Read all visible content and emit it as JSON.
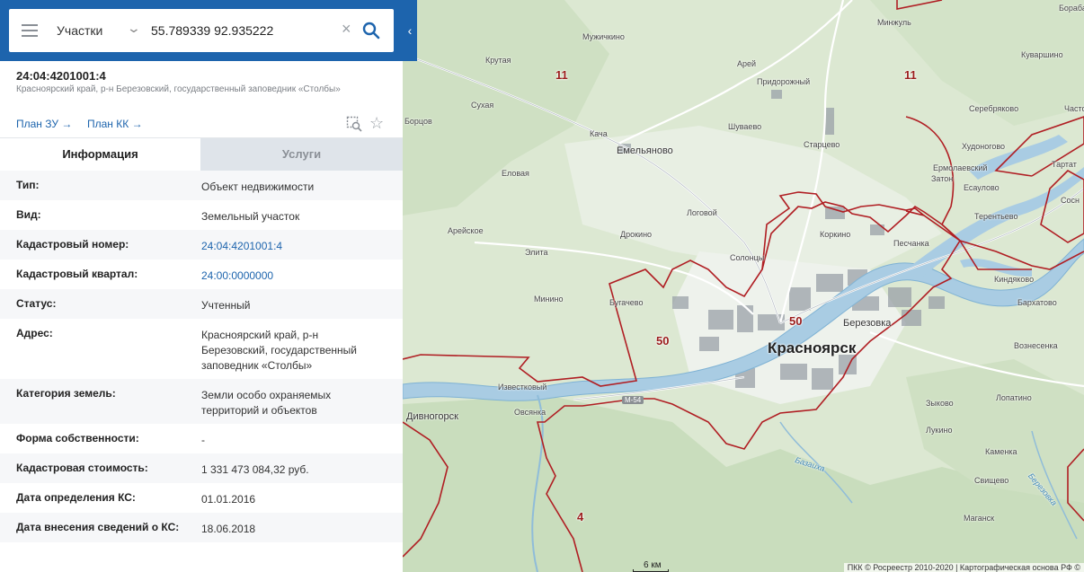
{
  "search": {
    "type_label": "Участки",
    "query": "55.789339 92.935222"
  },
  "icons": {
    "menu": "menu-icon",
    "chevron": "chevron-down-icon",
    "clear": "close-icon",
    "search": "search-icon",
    "collapse": "chevron-left-icon",
    "zoom": "zoom-to-object-icon",
    "favorite": "star-icon"
  },
  "colors": {
    "brand": "#1d64ad",
    "link": "#1d64ad",
    "boundary": "#b01e23",
    "zone_label": "#9b1c1c"
  },
  "object": {
    "cadastral_number": "24:04:4201001:4",
    "address_short": "Красноярский край, р-н Березовский, государственный заповедник «Столбы»"
  },
  "plans": {
    "zu": "План ЗУ →",
    "kk": "План КК →"
  },
  "tabs": {
    "info": "Информация",
    "services": "Услуги"
  },
  "info_rows": [
    {
      "key": "Тип:",
      "value": "Объект недвижимости"
    },
    {
      "key": "Вид:",
      "value": "Земельный участок"
    },
    {
      "key": "Кадастровый номер:",
      "value": "24:04:4201001:4"
    },
    {
      "key": "Кадастровый квартал:",
      "value": "24:00:0000000"
    },
    {
      "key": "Статус:",
      "value": "Учтенный"
    },
    {
      "key": "Адрес:",
      "value": "Красноярский край, р-н Березовский, государственный заповедник «Столбы»"
    },
    {
      "key": "Категория земель:",
      "value": "Земли особо охраняемых территорий и объектов"
    },
    {
      "key": "Форма собственности:",
      "value": "-"
    },
    {
      "key": "Кадастровая стоимость:",
      "value": "1 331 473 084,32 руб."
    },
    {
      "key": "Дата определения КС:",
      "value": "01.01.2016"
    },
    {
      "key": "Дата внесения сведений о КС:",
      "value": "18.06.2018"
    }
  ],
  "map": {
    "city": "Красноярск",
    "places": [
      "Бораба",
      "Минжуль",
      "Кувар­шино",
      "Мужичкино",
      "Крутая",
      "Арей",
      "Придорожный",
      "Часто",
      "Серебряково",
      "Сухая",
      "Борцов",
      "Шуваево",
      "Кача",
      "Емельяново",
      "Старцево",
      "Худоногово",
      "Тартат",
      "Ермолаевский",
      "Затон",
      "Есаулово",
      "Еловая",
      "Сосн",
      "Логовой",
      "Терентьево",
      "Арейское",
      "Коркино",
      "Дрокино",
      "Песчанка",
      "Элита",
      "Солонцы",
      "Киндяково",
      "Минино",
      "Бугачево",
      "Березовка",
      "Бархатово",
      "Вознесенка",
      "Известковый",
      "Зыково",
      "Овсянка",
      "Дивногорск",
      "Лопатино",
      "Лукино",
      "Каменка",
      "Свищево",
      "Маганск"
    ],
    "zones": [
      "11",
      "11",
      "50",
      "50",
      "4"
    ],
    "road": "М-54",
    "rivers": [
      "Базаиха",
      "Березовка"
    ],
    "scale": "6 км",
    "copyright": "ПКК © Росреестр 2010-2020 | Картографическая основа РФ ©"
  }
}
